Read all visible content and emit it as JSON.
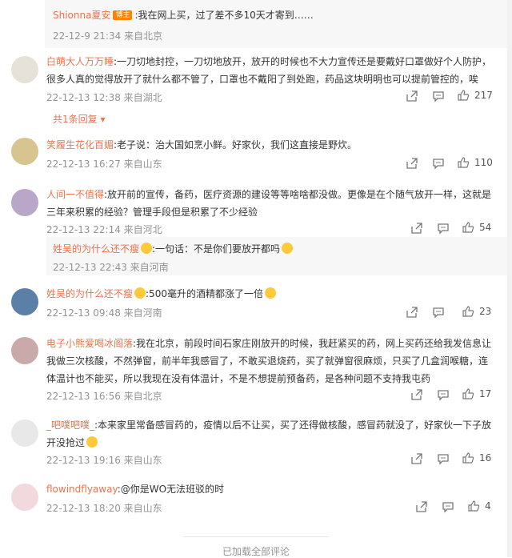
{
  "comments": [
    {
      "user": "Shionna夏安",
      "badge": "博主",
      "text": ":我在网上买，过了差不多10天才寄到……",
      "meta": "22-12-9 21:34 来自北京"
    },
    {
      "user": "白萌大人万万睡",
      "text1": ":一刀切地封控，一刀切地放开，放开的时候也不大力宣传还是要戴好口罩做好个人防护，",
      "text2": "很多人真的觉得放开了就什么都不管了，口罩也不戴阳了到处跑，药品这块明明也可以提前管控的，唉",
      "meta": "22-12-13 12:38 来自湖北",
      "likes": "217"
    },
    {
      "replies": "共1条回复"
    },
    {
      "user": "笑履生花化百媚",
      "text": ":老子说：治大国如烹小鲜。好家伙，我们这直接是野炊。",
      "meta": "22-12-13 16:27 来自山东",
      "likes": "110"
    },
    {
      "user": "人间一不值得",
      "text1": ":放开前的宣传，备药，医疗资源的建设等等啥啥都没做。更像是在个随气放开一样，这就是",
      "text2": "三年来积累的经验？管理手段但是积累了不少经验",
      "meta": "22-12-13 22:14 来自河北",
      "likes": "54"
    },
    {
      "user": "姓吴的为什么还不瘦",
      "text": ":一句话：不是你们要放开都吗",
      "meta": "22-12-13 22:43 来自河南"
    },
    {
      "user": "姓吴的为什么还不瘦",
      "text": ":500毫升的酒精都涨了一倍",
      "meta": "22-12-13 09:48 来自河南",
      "likes": "23"
    },
    {
      "user": "电子小熊爱喝冰阁落",
      "text1": ":我在北京，前段时间石家庄刚放开的时候，我赶紧买的药，网上买药还给我发信息让",
      "text2": "我做三次核酸，不然弹窗，前半年我感冒了，不敢买退烧药，买了就弹窗很麻烦，只买了几盒润喉糖，连",
      "text3": "体温计也不能买，所以我现在没有体温计，不是不想提前预备药，是各种问题不支持我屯药",
      "meta": "22-12-13 16:56 来自北京",
      "likes": "17"
    },
    {
      "user": "_吧噗吧噗_",
      "text1": ":本来家里常备感冒药的，疫情以后不让买，买了还得做核酸，感冒药就没了，好家伙一下子放",
      "text2": "开没抢过",
      "meta": "22-12-13 19:16 来自山东",
      "likes": "16"
    },
    {
      "user": "flowindflyaway",
      "text": ":@你是WO无法班驳的时",
      "meta": "22-12-13 18:20 来自山东",
      "likes": "4"
    }
  ],
  "footer": "已加载全部评论"
}
